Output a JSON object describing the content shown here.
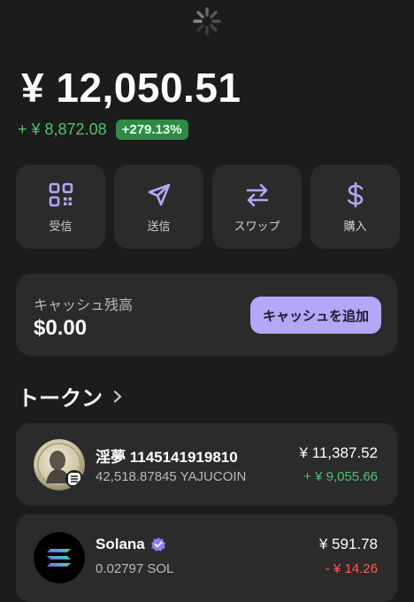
{
  "portfolio": {
    "balance": "¥ 12,050.51",
    "change_amount": "+ ¥ 8,872.08",
    "change_percent": "+279.13%"
  },
  "actions": [
    {
      "label": "受信",
      "icon": "qr-code-icon"
    },
    {
      "label": "送信",
      "icon": "send-icon"
    },
    {
      "label": "スワップ",
      "icon": "swap-icon"
    },
    {
      "label": "購入",
      "icon": "dollar-icon"
    }
  ],
  "cash": {
    "title": "キャッシュ残高",
    "value": "$0.00",
    "button_label": "キャッシュを追加"
  },
  "tokens": {
    "title": "トークン",
    "items": [
      {
        "name": "淫夢 1145141919810",
        "amount": "42,518.87845 YAJUCOIN",
        "value": "¥ 11,387.52",
        "change": "+ ¥ 9,055.66"
      },
      {
        "name": "Solana",
        "amount": "0.02797 SOL",
        "value": "¥ 591.78",
        "change": "- ¥ 14.26"
      }
    ]
  },
  "colors": {
    "background": "#1c1c1c",
    "card": "#2b2b2b",
    "accent": "#b5a6f8",
    "positive": "#4fc36b",
    "negative": "#ff5a4f"
  }
}
